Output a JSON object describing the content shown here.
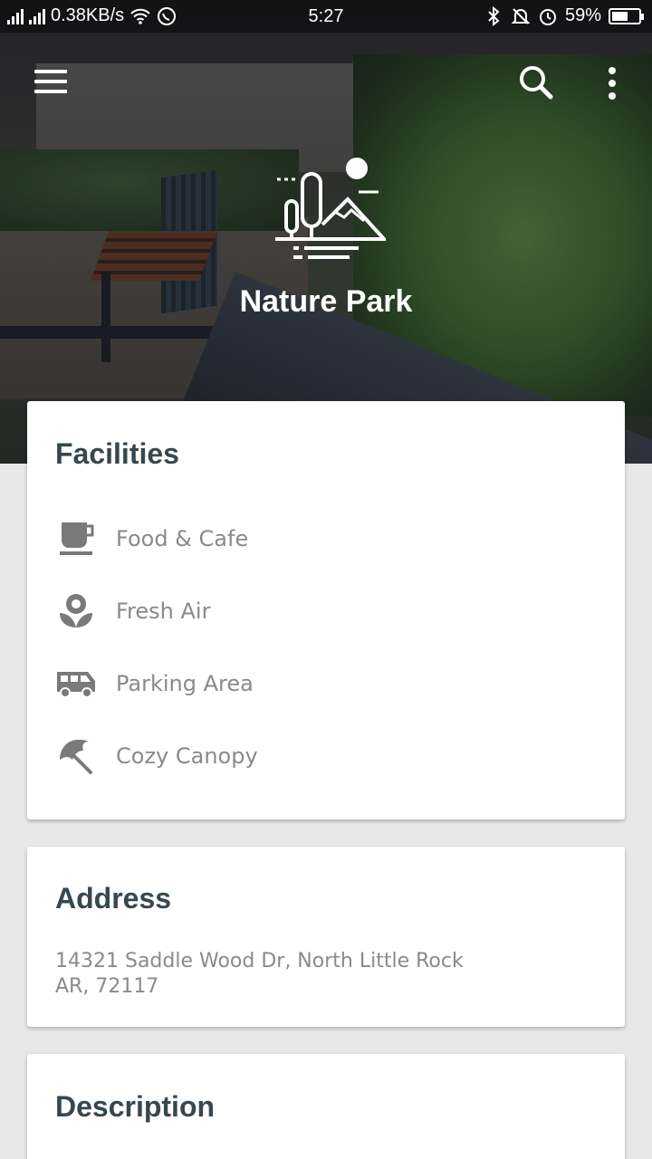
{
  "status_bar": {
    "network_speed": "0.38KB/s",
    "time": "5:27",
    "battery": "59%",
    "battery_level": 0.59,
    "icons": [
      "signal-icon",
      "wifi-icon",
      "whatsapp-icon",
      "bluetooth-icon",
      "mute-icon",
      "alarm-icon",
      "battery-icon"
    ]
  },
  "app_bar": {
    "icons": [
      "menu-icon",
      "search-icon",
      "more-vert-icon"
    ]
  },
  "header": {
    "title": "Nature Park",
    "logo_icon": "nature-park-logo-icon"
  },
  "facilities": {
    "heading": "Facilities",
    "items": [
      {
        "label": "Food & Cafe",
        "icon": "coffee-cup-icon"
      },
      {
        "label": "Fresh Air",
        "icon": "flower-icon"
      },
      {
        "label": "Parking Area",
        "icon": "bus-icon"
      },
      {
        "label": "Cozy Canopy",
        "icon": "umbrella-icon"
      }
    ]
  },
  "address": {
    "heading": "Address",
    "line1": "14321 Saddle Wood Dr, North Little Rock",
    "line2": "AR, 72117"
  },
  "description": {
    "heading": "Description"
  },
  "colors": {
    "heading_text": "#37474f",
    "body_text": "#8a8a8a",
    "icon_gray": "#7a7a7a",
    "background": "#e8e8e8"
  }
}
